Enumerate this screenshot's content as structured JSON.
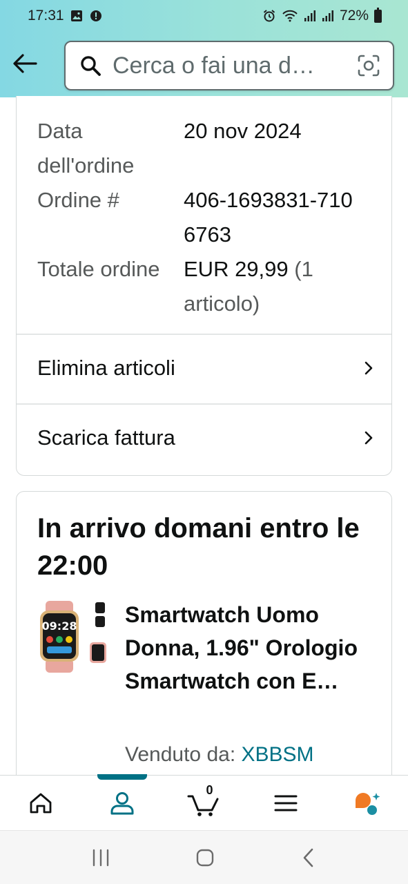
{
  "status_bar": {
    "time": "17:31",
    "battery": "72%"
  },
  "search": {
    "placeholder": "Cerca o fai una d…"
  },
  "order": {
    "date_label": "Data dell'ordine",
    "date_value": "20 nov 2024",
    "number_label": "Ordine #",
    "number_value": "406-1693831-7106763",
    "total_label": "Totale ordine",
    "total_value": "EUR 29,99",
    "total_items": "(1 articolo)",
    "remove_items": "Elimina articoli",
    "download_invoice": "Scarica fattura"
  },
  "delivery": {
    "title": "In arrivo domani entro le 22:00",
    "product_title": "Smartwatch Uomo Donna, 1.96\" Orologio Smartwatch con E…",
    "product_image_clock": "09:28",
    "sold_by_label": "Venduto da:",
    "seller": "XBBSM"
  },
  "bottom_nav": {
    "items": [
      "home-icon",
      "account-icon",
      "cart-icon",
      "menu-icon",
      "rufus-icon"
    ],
    "active": "account-icon",
    "cart_count": "0"
  },
  "colors": {
    "accent": "#007185",
    "orange": "#f07a24"
  }
}
